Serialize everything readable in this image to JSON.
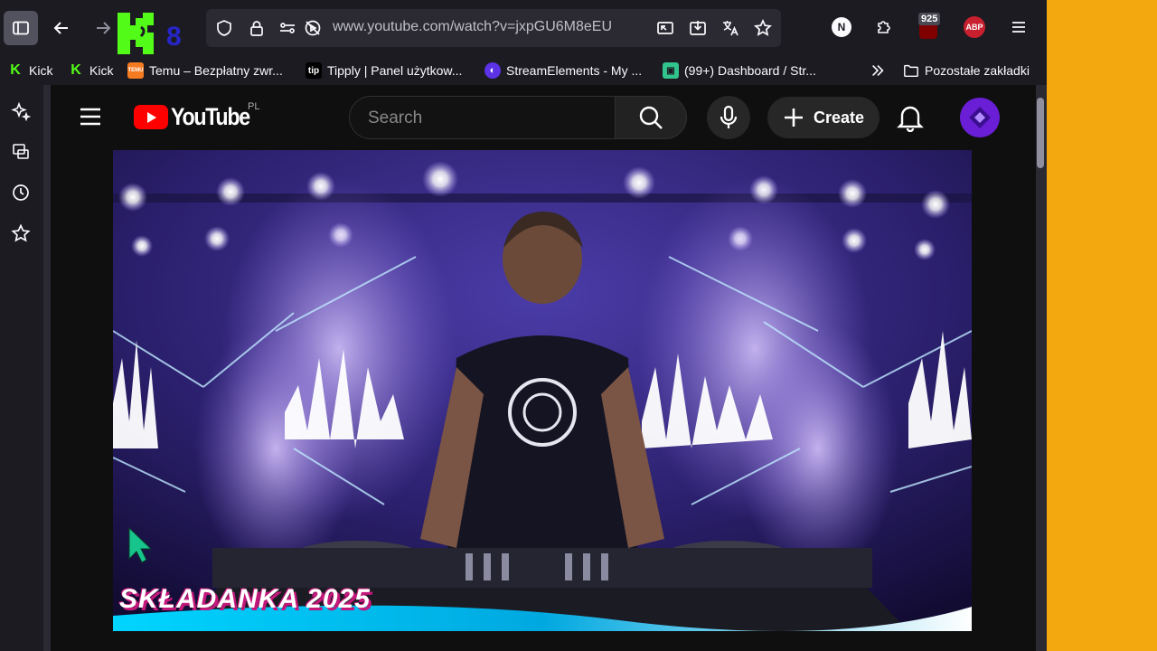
{
  "browser": {
    "url": "www.youtube.com/watch?v=jxpGU6M8eEU",
    "extensions": {
      "ublock_count": "925",
      "n_label": "N",
      "abp_label": "ABP"
    },
    "bookmarks": [
      {
        "label": "Kick",
        "icon": "kick-icon",
        "color": "#53fc18"
      },
      {
        "label": "Kick",
        "icon": "kick-icon",
        "color": "#53fc18"
      },
      {
        "label": "Temu – Bezpłatny zwr...",
        "icon": "temu-icon",
        "color": "#f57b21"
      },
      {
        "label": "Tipply | Panel użytkow...",
        "icon": "tip-icon",
        "color": "#000000"
      },
      {
        "label": "StreamElements - My ...",
        "icon": "streamelements-icon",
        "color": "#5b32e6"
      },
      {
        "label": "(99+) Dashboard / Str...",
        "icon": "dashboard-icon",
        "color": "#31c48d"
      }
    ],
    "overflow_folder": "Pozostałe zakładki"
  },
  "youtube": {
    "logo_text": "YouTube",
    "country_code": "PL",
    "search_placeholder": "Search",
    "create_label": "Create"
  },
  "video": {
    "overlay_title": "SKŁADANKA 2025"
  },
  "colors": {
    "accent_right_panel": "#f3a810",
    "yt_red": "#ff0000",
    "avatar_purple": "#6a1fd6"
  }
}
